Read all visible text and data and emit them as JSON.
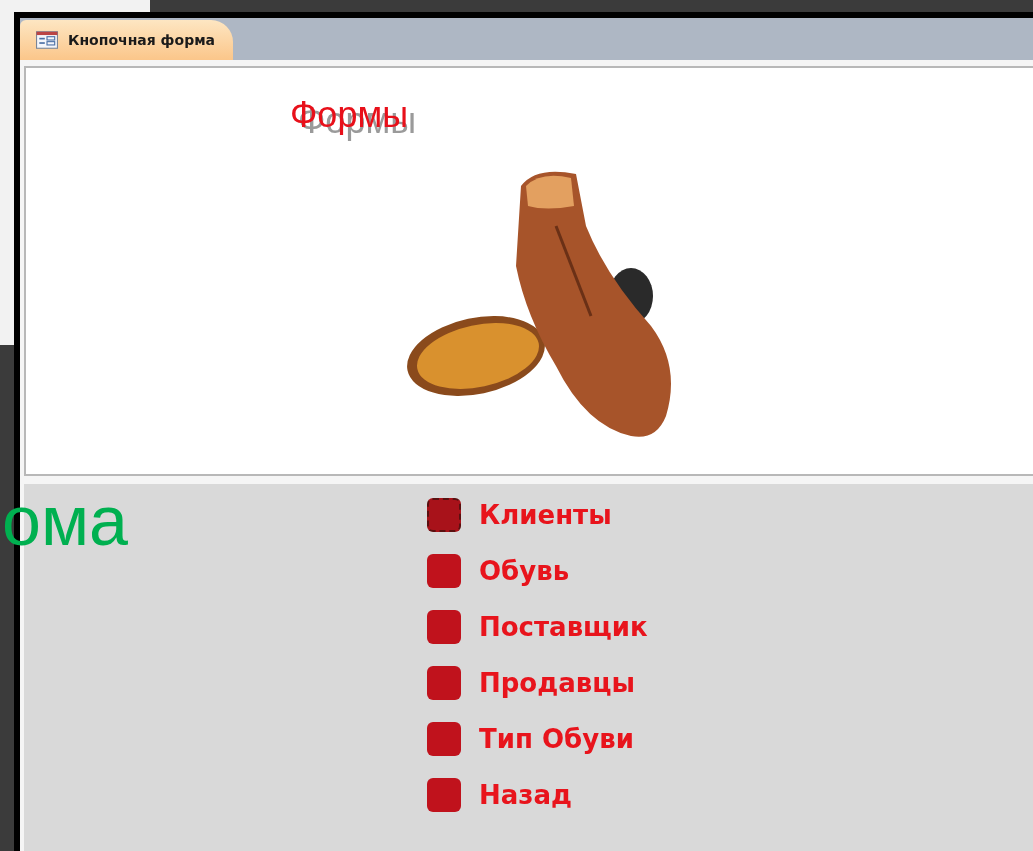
{
  "slide": {
    "caption": "ома"
  },
  "form": {
    "tab": {
      "label": "Кнопочная форма",
      "selected": true
    },
    "header": {
      "title": "Формы"
    },
    "buttons": [
      {
        "label": "Клиенты",
        "focused": true
      },
      {
        "label": "Обувь",
        "focused": false
      },
      {
        "label": "Поставщик",
        "focused": false
      },
      {
        "label": "Продавцы",
        "focused": false
      },
      {
        "label": "Тип Обуви",
        "focused": false
      },
      {
        "label": "Назад",
        "focused": false
      }
    ]
  }
}
